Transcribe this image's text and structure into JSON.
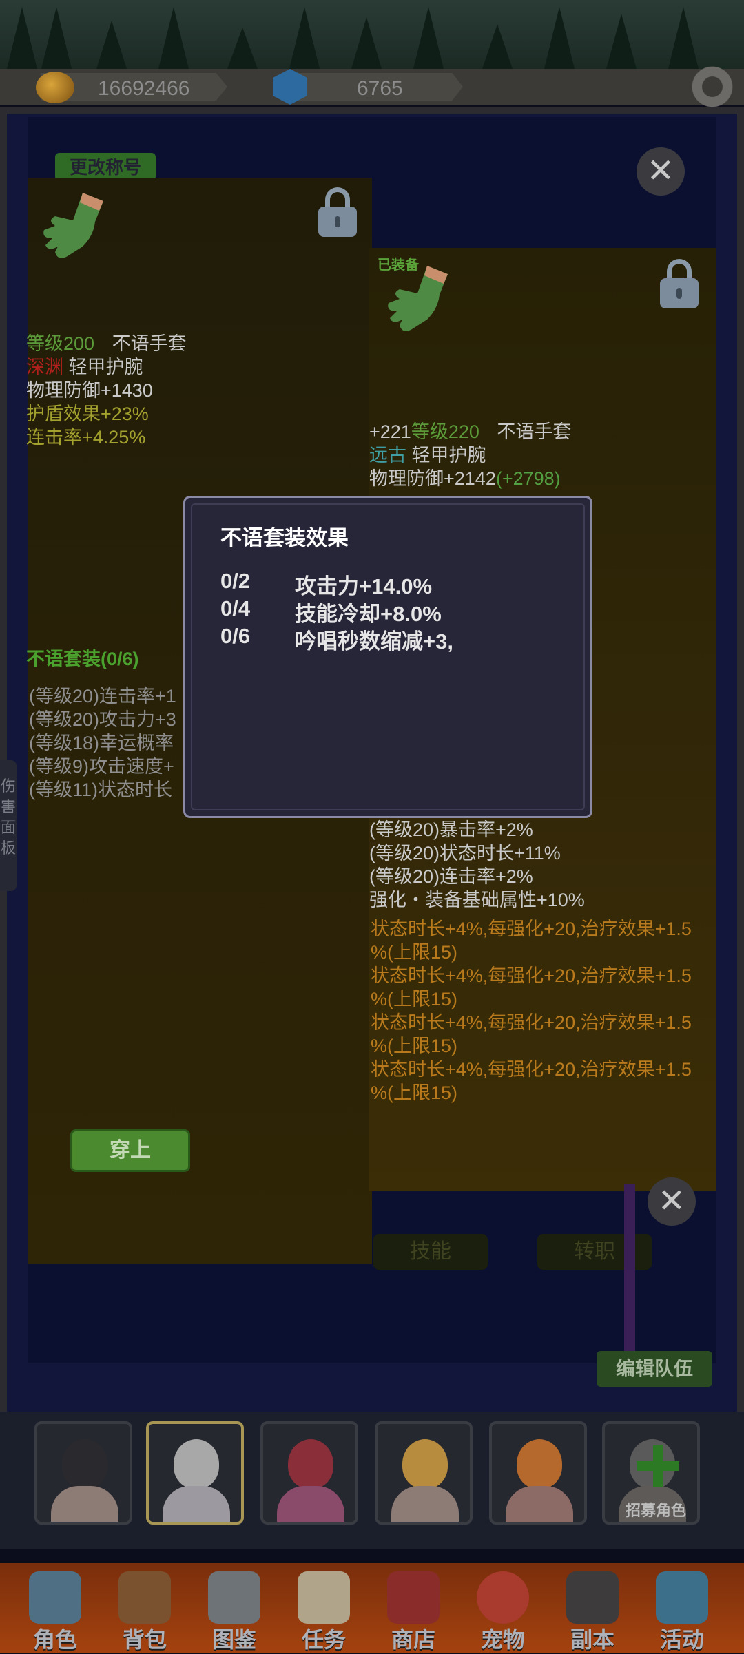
{
  "currency": {
    "coins": "16692466",
    "gems": "6765"
  },
  "buttons": {
    "rename": "更改称号",
    "wear": "穿上",
    "skill": "技能",
    "job_change": "转职",
    "edit_team": "编辑队伍",
    "close": "✕"
  },
  "side_tab": {
    "label": "伤害面板"
  },
  "left_item": {
    "level_label": "等级",
    "level_value": "200",
    "name": "不语手套",
    "quality": "深渊",
    "type": "轻甲护腕",
    "phys_def": "物理防御+1430",
    "shield": "护盾效果+23%",
    "combo": "连击率+4.25%",
    "set_title": "不语套装(0/6)",
    "set_lines": [
      "(等级20)连击率+1",
      "(等级20)攻击力+3",
      "(等级18)幸运概率",
      "(等级9)攻击速度+",
      "(等级11)状态时长"
    ]
  },
  "right_item": {
    "equipped_tag": "已装备",
    "enhance": "+221",
    "level_label": "等级",
    "level_value": "220",
    "name": "不语手套",
    "quality": "远古",
    "type": "轻甲护腕",
    "phys_def": "物理防御+2142",
    "phys_def_bonus": "(+2798)",
    "stat_lines": [
      "(等级20)暴击率+2%",
      "(等级20)状态时长+11%",
      "(等级20)连击率+2%",
      "强化・装备基础属性+10%"
    ],
    "orange_lines": [
      "状态时长+4%,每强化+20,治疗效果+1.5",
      "%(上限15)",
      "状态时长+4%,每强化+20,治疗效果+1.5",
      "%(上限15)",
      "状态时长+4%,每强化+20,治疗效果+1.5",
      "%(上限15)",
      "状态时长+4%,每强化+20,治疗效果+1.5",
      "%(上限15)"
    ]
  },
  "modal": {
    "title": "不语套装效果",
    "rows": [
      {
        "count": "0/2",
        "effect": "攻击力+14.0%"
      },
      {
        "count": "0/4",
        "effect": "技能冷却+8.0%"
      },
      {
        "count": "0/6",
        "effect": "吟唱秒数缩减+3,"
      }
    ]
  },
  "characters": {
    "recruit_label": "招募角色"
  },
  "nav": [
    {
      "label": "角色",
      "icon": "helmet-icon"
    },
    {
      "label": "背包",
      "icon": "backpack-icon"
    },
    {
      "label": "图鉴",
      "icon": "book-icon"
    },
    {
      "label": "任务",
      "icon": "scroll-icon"
    },
    {
      "label": "商店",
      "icon": "shop-icon"
    },
    {
      "label": "宠物",
      "icon": "meat-icon"
    },
    {
      "label": "副本",
      "icon": "skull-icon"
    },
    {
      "label": "活动",
      "icon": "calendar-icon"
    }
  ],
  "colors": {
    "level_green": "#5c9b3a",
    "quality_red": "#b0201c",
    "quality_teal": "#3f9da4",
    "bonus_orange": "#b87a1c"
  }
}
